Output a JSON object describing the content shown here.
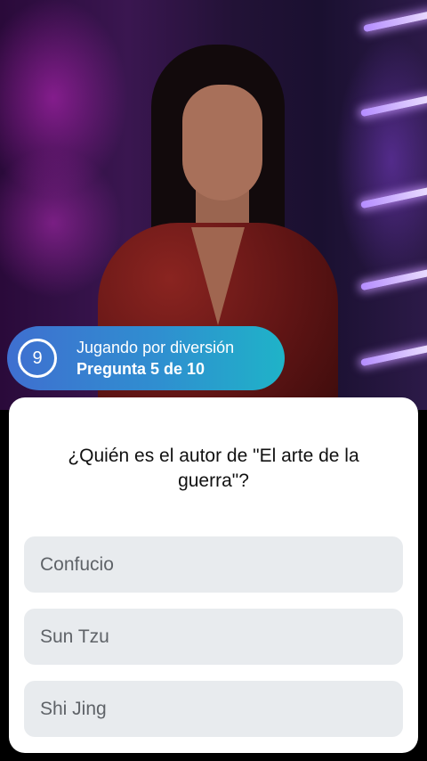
{
  "video": {
    "background_icon": "presenter-video"
  },
  "status": {
    "timer": "9",
    "mode": "Jugando por diversión",
    "progress": "Pregunta 5 de 10",
    "gradient_start": "#3f6fd0",
    "gradient_end": "#1fb3c8"
  },
  "quiz": {
    "question": "¿Quién es el autor de \"El arte de la guerra\"?",
    "answers": [
      {
        "label": "Confucio"
      },
      {
        "label": "Sun Tzu"
      },
      {
        "label": "Shi Jing"
      }
    ],
    "answer_bg": "#e8ebee",
    "answer_text_color": "#5f6368"
  }
}
